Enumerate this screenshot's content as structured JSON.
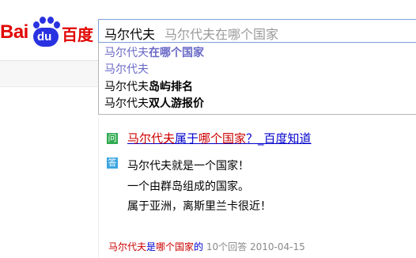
{
  "logo": {
    "latin": "Bai",
    "paw_text": "du",
    "chinese": "百度"
  },
  "search": {
    "query": "马尔代夫",
    "hint": "马尔代夫在哪个国家"
  },
  "suggestions": [
    {
      "prefix": "马尔代夫",
      "suffix": "在哪个国家",
      "selected": true
    },
    {
      "prefix": "马尔代夫",
      "suffix": "",
      "selected": true
    },
    {
      "prefix": "马尔代夫",
      "suffix": "岛屿排名",
      "selected": false
    },
    {
      "prefix": "马尔代夫",
      "suffix": "双人游报价",
      "selected": false
    }
  ],
  "qa": {
    "question_badge": "问",
    "answer_badge": "答",
    "title_keyword": "马尔代夫",
    "title_mid": "属于",
    "title_keyword2": "哪个国家",
    "title_rest": "？_百度知道",
    "answer_lines": [
      "马尔代夫就是一个国家！",
      "一个由群岛组成的国家。",
      "属于亚洲，离斯里兰卡很近！"
    ],
    "meta_keyword": "马尔代夫",
    "meta_mid": "是",
    "meta_keyword2": "哪个国家",
    "meta_rest": "的",
    "meta_count": "10个回答",
    "meta_date": "2010-04-15"
  }
}
